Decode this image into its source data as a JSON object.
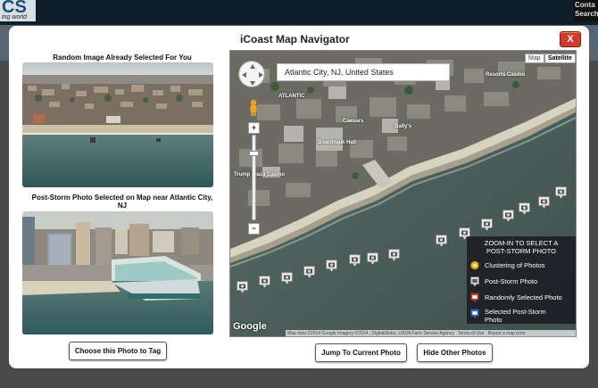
{
  "background": {
    "logo_text": "CS",
    "logo_sub": "ing world",
    "contact_line1": "Conta",
    "contact_line2": "Search"
  },
  "modal": {
    "title": "iCoast Map Navigator",
    "close_label": "X"
  },
  "random_photo": {
    "caption": "Random Image Already Selected For You"
  },
  "post_storm_photo": {
    "caption": "Post-Storm Photo Selected on Map near Atlantic City, NJ"
  },
  "buttons": {
    "choose_tag": "Choose this Photo to Tag",
    "jump_current": "Jump To Current Photo",
    "hide_others": "Hide Other Photos"
  },
  "map": {
    "search_value": "Atlantic City, NJ, United States",
    "map_types": [
      "Map",
      "Satellite"
    ],
    "selected_map_type": "Satellite",
    "place_labels": [
      "ATLANTIC",
      "Resorts Casino",
      "Caesars",
      "Bally's",
      "Boardwalk Hall",
      "Trump Plaza Casino"
    ],
    "legend": {
      "heading_line1": "ZOOM-IN TO SELECT A",
      "heading_line2": "POST-STORM PHOTO",
      "items": [
        {
          "label": "Clustering of Photos",
          "icon": "cluster-icon",
          "color": "#e8b321"
        },
        {
          "label": "Post-Storm Photo",
          "icon": "post-storm-marker-icon",
          "color": "#d8d8d8"
        },
        {
          "label": "Randomly Selected Photo",
          "icon": "random-marker-icon",
          "color": "#c0392b"
        },
        {
          "label": "Selected Post-Storm Photo",
          "icon": "selected-marker-icon",
          "color": "#2f64b8"
        }
      ]
    },
    "google_logo": "Google",
    "attribution": "Map data ©2014 Google Imagery ©2014 , DigitalGlobe, USDA Farm Service Agency",
    "terms": "Terms of Use",
    "report": "Report a map error"
  }
}
